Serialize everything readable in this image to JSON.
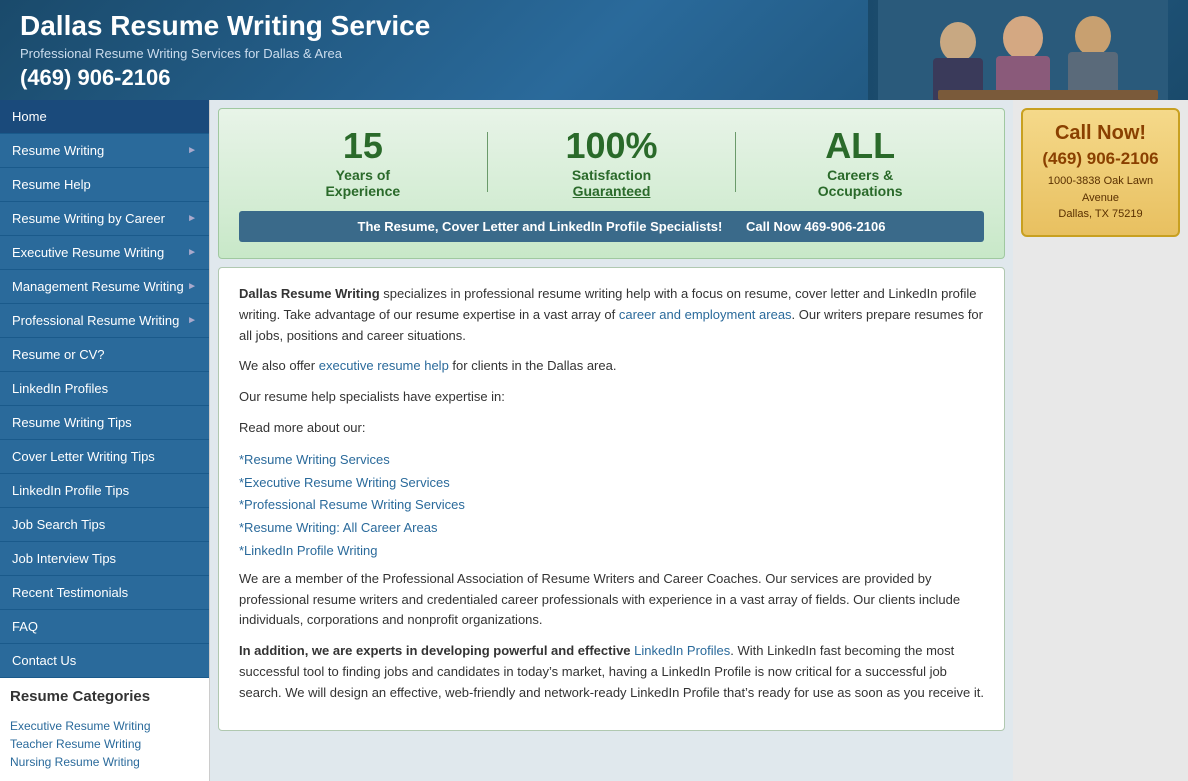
{
  "header": {
    "title": "Dallas Resume Writing Service",
    "subtitle": "Professional Resume Writing Services for Dallas & Area",
    "phone": "(469) 906-2106"
  },
  "sidebar": {
    "nav_items": [
      {
        "label": "Home",
        "has_arrow": false,
        "active": true
      },
      {
        "label": "Resume Writing",
        "has_arrow": true
      },
      {
        "label": "Resume Help",
        "has_arrow": false
      },
      {
        "label": "Resume Writing by Career",
        "has_arrow": true
      },
      {
        "label": "Executive Resume Writing",
        "has_arrow": true
      },
      {
        "label": "Management Resume Writing",
        "has_arrow": true
      },
      {
        "label": "Professional Resume Writing",
        "has_arrow": true
      },
      {
        "label": "Resume or CV?",
        "has_arrow": false
      },
      {
        "label": "LinkedIn Profiles",
        "has_arrow": false
      },
      {
        "label": "Resume Writing Tips",
        "has_arrow": false
      },
      {
        "label": "Cover Letter Writing Tips",
        "has_arrow": false
      },
      {
        "label": "LinkedIn Profile Tips",
        "has_arrow": false
      },
      {
        "label": "Job Search Tips",
        "has_arrow": false
      },
      {
        "label": "Job Interview Tips",
        "has_arrow": false
      },
      {
        "label": "Recent Testimonials",
        "has_arrow": false
      },
      {
        "label": "FAQ",
        "has_arrow": false
      },
      {
        "label": "Contact Us",
        "has_arrow": false
      }
    ],
    "categories_title": "Resume Categories",
    "categories": [
      "Executive Resume Writing",
      "Teacher Resume Writing",
      "Nursing Resume Writing"
    ]
  },
  "banner": {
    "stat1_big": "15",
    "stat1_label1": "Years of",
    "stat1_label2": "Experience",
    "stat2_big": "100%",
    "stat2_label1": "Satisfaction",
    "stat2_label2": "Guaranteed",
    "stat3_big": "ALL",
    "stat3_label1": "Careers &",
    "stat3_label2": "Occupations",
    "tagline": "The Resume, Cover Letter and LinkedIn Profile Specialists!",
    "tagline_cta": "Call Now 469-906-2106"
  },
  "content": {
    "p1_start": "Dallas Resume Writing",
    "p1_rest": " specializes in professional resume writing help with a focus on resume, cover letter and LinkedIn profile writing. Take advantage of our resume expertise in a vast array of ",
    "p1_link": "career and employment areas",
    "p1_end": ". Our writers prepare resumes for all jobs, positions and career situations.",
    "p2_start": "We also offer ",
    "p2_link": "executive resume help",
    "p2_end": " for clients in the Dallas area.",
    "p3": "Our resume help specialists have expertise in:",
    "p4": "Read more about our:",
    "links": [
      {
        "label": "*Resume Writing Services",
        "href": "#"
      },
      {
        "label": "*Executive Resume Writing Services",
        "href": "#"
      },
      {
        "label": "*Professional Resume Writing Services",
        "href": "#"
      },
      {
        "label": "*Resume Writing: All Career Areas",
        "href": "#"
      },
      {
        "label": "*LinkedIn Profile Writing",
        "href": "#"
      }
    ],
    "p5": "We are a member of the Professional Association of Resume Writers and Career Coaches. Our services are provided by professional resume writers and credentialed career professionals with experience in a vast array of fields. Our clients include individuals, corporations and nonprofit organizations.",
    "p6_start": "In addition, we are experts in developing powerful and effective ",
    "p6_link": "LinkedIn Profiles",
    "p6_end": ". With LinkedIn fast becoming the most successful tool to finding jobs and candidates in today’s market, having a LinkedIn Profile is now critical for a successful job search. We will design an effective, web-friendly and network-ready LinkedIn Profile that’s ready for use as soon as you receive it."
  },
  "right_sidebar": {
    "call_now": "Call Now!",
    "phone": "(469) 906-2106",
    "address_line1": "1000-3838 Oak Lawn Avenue",
    "address_line2": "Dallas, TX 75219"
  }
}
